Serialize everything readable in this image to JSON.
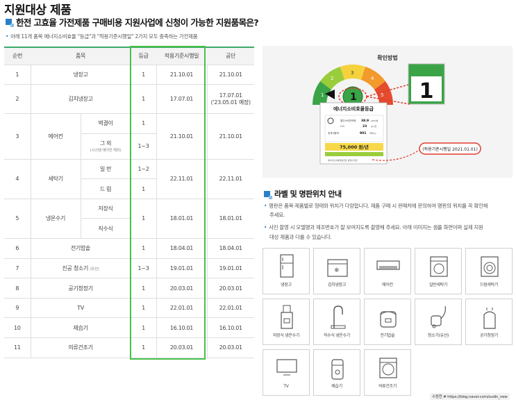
{
  "page": {
    "title": "지원대상 제품",
    "question": "한전 고효율 가전제품 구매비용 지원사업에 신청이 가능한 지원품목은?",
    "note": "아래 11개 품목 에너지소비효율 \"등급\"과 \"적용기준시행일\" 2가지 모두 충족하는 가전제품"
  },
  "table": {
    "headers": [
      "순번",
      "품목",
      "등급",
      "적용기준시행일",
      "공단"
    ],
    "rows": [
      {
        "no": "1",
        "item": "냉장고",
        "grade": "1",
        "date": "21.10.01",
        "agency": "21.10.01"
      },
      {
        "no": "2",
        "item": "김치냉장고",
        "grade": "1",
        "date": "17.07.01",
        "agency": "17.07.01",
        "agency_note": "('23.05.01 예정)"
      },
      {
        "no": "3",
        "item": "에어컨",
        "sub1": "벽결이",
        "grade1": "1",
        "sub2": "그 외",
        "sub2_note": "(시스템 에어컨 제외)",
        "grade2": "1~3",
        "date": "21.10.01",
        "agency": "21.10.01"
      },
      {
        "no": "4",
        "item": "세탁기",
        "sub1": "일 반",
        "grade1": "1~2",
        "sub2": "드 럼",
        "grade2": "1",
        "date": "22.11.01",
        "agency": "22.11.01"
      },
      {
        "no": "5",
        "item": "냉온수기",
        "sub1": "저장식",
        "sub2": "직수식",
        "grade": "1",
        "date": "18.01.01",
        "agency": "18.01.01"
      },
      {
        "no": "6",
        "item": "전기밥솥",
        "grade": "1",
        "date": "18.04.01",
        "agency": "18.04.01"
      },
      {
        "no": "7",
        "item": "진공 청소기",
        "item_note": "(유선)",
        "grade": "1~3",
        "date": "19.01.01",
        "agency": "19.01.01"
      },
      {
        "no": "8",
        "item": "공기청정기",
        "grade": "1",
        "date": "20.03.01",
        "agency": "20.03.01"
      },
      {
        "no": "9",
        "item": "TV",
        "grade": "1",
        "date": "22.01.01",
        "agency": "22.01.01"
      },
      {
        "no": "10",
        "item": "제습기",
        "grade": "1",
        "date": "16.10.01",
        "agency": "16.10.01"
      },
      {
        "no": "11",
        "item": "의류건조기",
        "grade": "1",
        "date": "20.03.01",
        "agency": "20.03.01"
      }
    ]
  },
  "label_panel": {
    "title": "확인방법",
    "gauge_numbers": [
      "1",
      "2",
      "3",
      "4",
      "5"
    ],
    "big_grade": "1",
    "label_title": "에너지소비효율등급",
    "spec1_name": "월간소비전력량",
    "spec1_value": "38.9",
    "spec1_unit": "kWh/월",
    "spec2_name": "CO₂",
    "spec2_value": "23",
    "spec2_unit": "g/시간",
    "spec3_name": "정격내용적",
    "spec3_value": "901",
    "spec3_unit": "리터(L)",
    "cost": "75,000 원/년",
    "bottom_text": "에너지소비효율등급은 설명서 참조",
    "callout": "(적용기준시행일 2021.01.01)"
  },
  "section2": {
    "title": "라벨 및 명판위치 안내",
    "bullet1": "명판은 품목·제품별로 형태와 위치가 다양합니다. 제품 구매 시 판매처에 문의하여 명판의 위치를 꼭 확인해",
    "bullet1b": "주세요.",
    "bullet2": "사진 촬영 시 모델명과 제조번호가 잘 보여지도록 촬영해 주세요. 아래 이미지는 샘플 화면이며 실제 지원",
    "bullet2b": "대상 제품과 다를 수 있습니다."
  },
  "products": [
    {
      "label": "냉장고",
      "icon": "refrigerator-icon"
    },
    {
      "label": "김치냉장고",
      "icon": "kimchi-fridge-icon"
    },
    {
      "label": "에어컨",
      "icon": "air-conditioner-icon"
    },
    {
      "label": "일반세탁기",
      "icon": "washer-icon"
    },
    {
      "label": "드럼세탁기",
      "icon": "drum-washer-icon"
    },
    {
      "label": "저장식 냉온수기",
      "icon": "water-dispenser-icon"
    },
    {
      "label": "직수식 냉온수기",
      "icon": "direct-water-icon"
    },
    {
      "label": "전기밥솥",
      "icon": "rice-cooker-icon"
    },
    {
      "label": "청소기(유선)",
      "icon": "vacuum-icon"
    },
    {
      "label": "공기청정기",
      "icon": "air-purifier-icon"
    },
    {
      "label": "TV",
      "icon": "tv-icon"
    },
    {
      "label": "제습기",
      "icon": "dehumidifier-icon"
    },
    {
      "label": "의류건조기",
      "icon": "dryer-icon"
    }
  ],
  "watermark": "수원천 # https://blog.naver.com/sudin_new",
  "colors": {
    "accent_blue": "#2a80c8",
    "frame_green": "#47c04a",
    "red": "#e03a2e"
  }
}
